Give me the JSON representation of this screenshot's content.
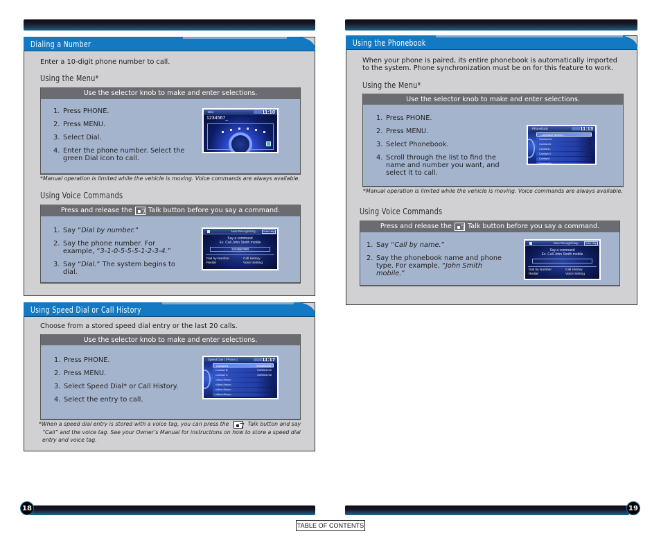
{
  "left_page": {
    "page_number": "18",
    "sections": {
      "dialing": {
        "title": "Dialing a Number",
        "intro": "Enter a 10-digit phone number to call.",
        "menu": {
          "subhead": "Using the Menu*",
          "instruction": "Use the selector knob to make and enter selections.",
          "steps": [
            {
              "num": "1.",
              "text": "Press PHONE."
            },
            {
              "num": "2.",
              "text": "Press MENU."
            },
            {
              "num": "3.",
              "text": "Select Dial."
            },
            {
              "num": "4.",
              "text": "Enter the phone number. Select the green Dial icon to call."
            }
          ],
          "screen": {
            "title": "Dial",
            "clock": "11:10",
            "number": "1234567_"
          },
          "footnote": "*Manual operation is limited while the vehicle is moving. Voice commands are always available."
        },
        "voice": {
          "subhead": "Using Voice Commands",
          "instruction_before": "Press and release the",
          "instruction_after": "Talk button before you say a command.",
          "talk_icon": "talk-button-icon",
          "steps": [
            {
              "num": "1.",
              "pre": "Say “",
              "em": "Dial by number.",
              "post": "”"
            },
            {
              "num": "2.",
              "pre": "Say the phone number. For example, “",
              "em": "3-1-0-5-5-5-1-2-3-4.",
              "post": "”"
            },
            {
              "num": "3.",
              "pre": "Say “",
              "em": "Dial.",
              "post": "”  The system begins to dial."
            }
          ],
          "screen": {
            "status": "Now Recognizing...",
            "help": "Voice Help",
            "prompt1": "Say a command",
            "prompt2": "Ex. Call John Smith mobile",
            "field": "1234567890",
            "options": [
              "Dial by Number",
              "Redial",
              "Call History",
              "Voice Setting"
            ]
          }
        }
      },
      "speed_dial": {
        "title": "Using Speed Dial or Call History",
        "intro": "Choose from a stored speed dial entry or the last 20 calls.",
        "instruction": "Use the selector knob to make and enter selections.",
        "steps": [
          {
            "num": "1.",
            "text": "Press PHONE."
          },
          {
            "num": "2.",
            "text": "Press MENU."
          },
          {
            "num": "3.",
            "text": "Select Speed Dial* or Call History."
          },
          {
            "num": "4.",
            "text": "Select the entry to call."
          }
        ],
        "screen": {
          "title": "Speed Dial ( iPhone )",
          "clock": "11:17",
          "rows": [
            {
              "name": "Contact A",
              "num": "3105551234"
            },
            {
              "name": "Contact B",
              "num": "3105551235"
            },
            {
              "name": "Contact C",
              "num": "3105551236"
            },
            {
              "name": "<New Entry>",
              "num": ""
            },
            {
              "name": "<New Entry>",
              "num": ""
            },
            {
              "name": "<New Entry>",
              "num": ""
            },
            {
              "name": "<New Entry>",
              "num": ""
            }
          ]
        },
        "footnote_lines": [
          {
            "pre": "*When a speed dial entry is stored with a voice tag, you can press the",
            "post": "Talk button and say"
          },
          {
            "pre": "“Call” and the voice tag. See your Owner’s Manual for instructions on how to store a speed dial",
            "post": ""
          },
          {
            "pre": "entry and voice tag.",
            "post": ""
          }
        ]
      }
    }
  },
  "right_page": {
    "page_number": "19",
    "phonebook": {
      "title": "Using the Phonebook",
      "intro": "When your phone is paired, its entire phonebook is automatically imported to the system. Phone synchronization must be on for this feature to work.",
      "menu": {
        "subhead": "Using the Menu*",
        "instruction": "Use the selector knob to make and enter selections.",
        "steps": [
          {
            "num": "1.",
            "text": "Press PHONE."
          },
          {
            "num": "2.",
            "text": "Press MENU."
          },
          {
            "num": "3.",
            "text": "Select Phonebook."
          },
          {
            "num": "4.",
            "text": "Scroll through the list to find the name and number you want, and select it to call."
          }
        ],
        "screen": {
          "title": "Phonebook",
          "clock": "11:13",
          "rows": [
            "-- Alphabet Search --",
            "Contact M",
            "Contact A",
            "Contact L",
            "Contact V",
            "Contact I",
            "Contact N"
          ]
        },
        "footnote": "*Manual operation is limited while the vehicle is moving. Voice commands are always available."
      },
      "voice": {
        "subhead": "Using Voice Commands",
        "instruction_before": "Press and release the",
        "instruction_after": "Talk button before you say a command.",
        "steps": [
          {
            "num": "1.",
            "pre": "Say “",
            "em": "Call by name.",
            "post": "”"
          },
          {
            "num": "2.",
            "pre": "Say the phonebook name and phone type. For example, “",
            "em": "John Smith mobile.",
            "post": "”"
          }
        ],
        "screen": {
          "status": "Now Recognizing...",
          "help": "Voice Help",
          "prompt1": "Say a command",
          "prompt2": "Ex. Call John Smith mobile",
          "field": "",
          "options": [
            "Dial by Number",
            "Redial",
            "Call History",
            "Voice Setting"
          ]
        }
      }
    }
  },
  "footer": {
    "toc_link": "TABLE OF CONTENTS"
  }
}
